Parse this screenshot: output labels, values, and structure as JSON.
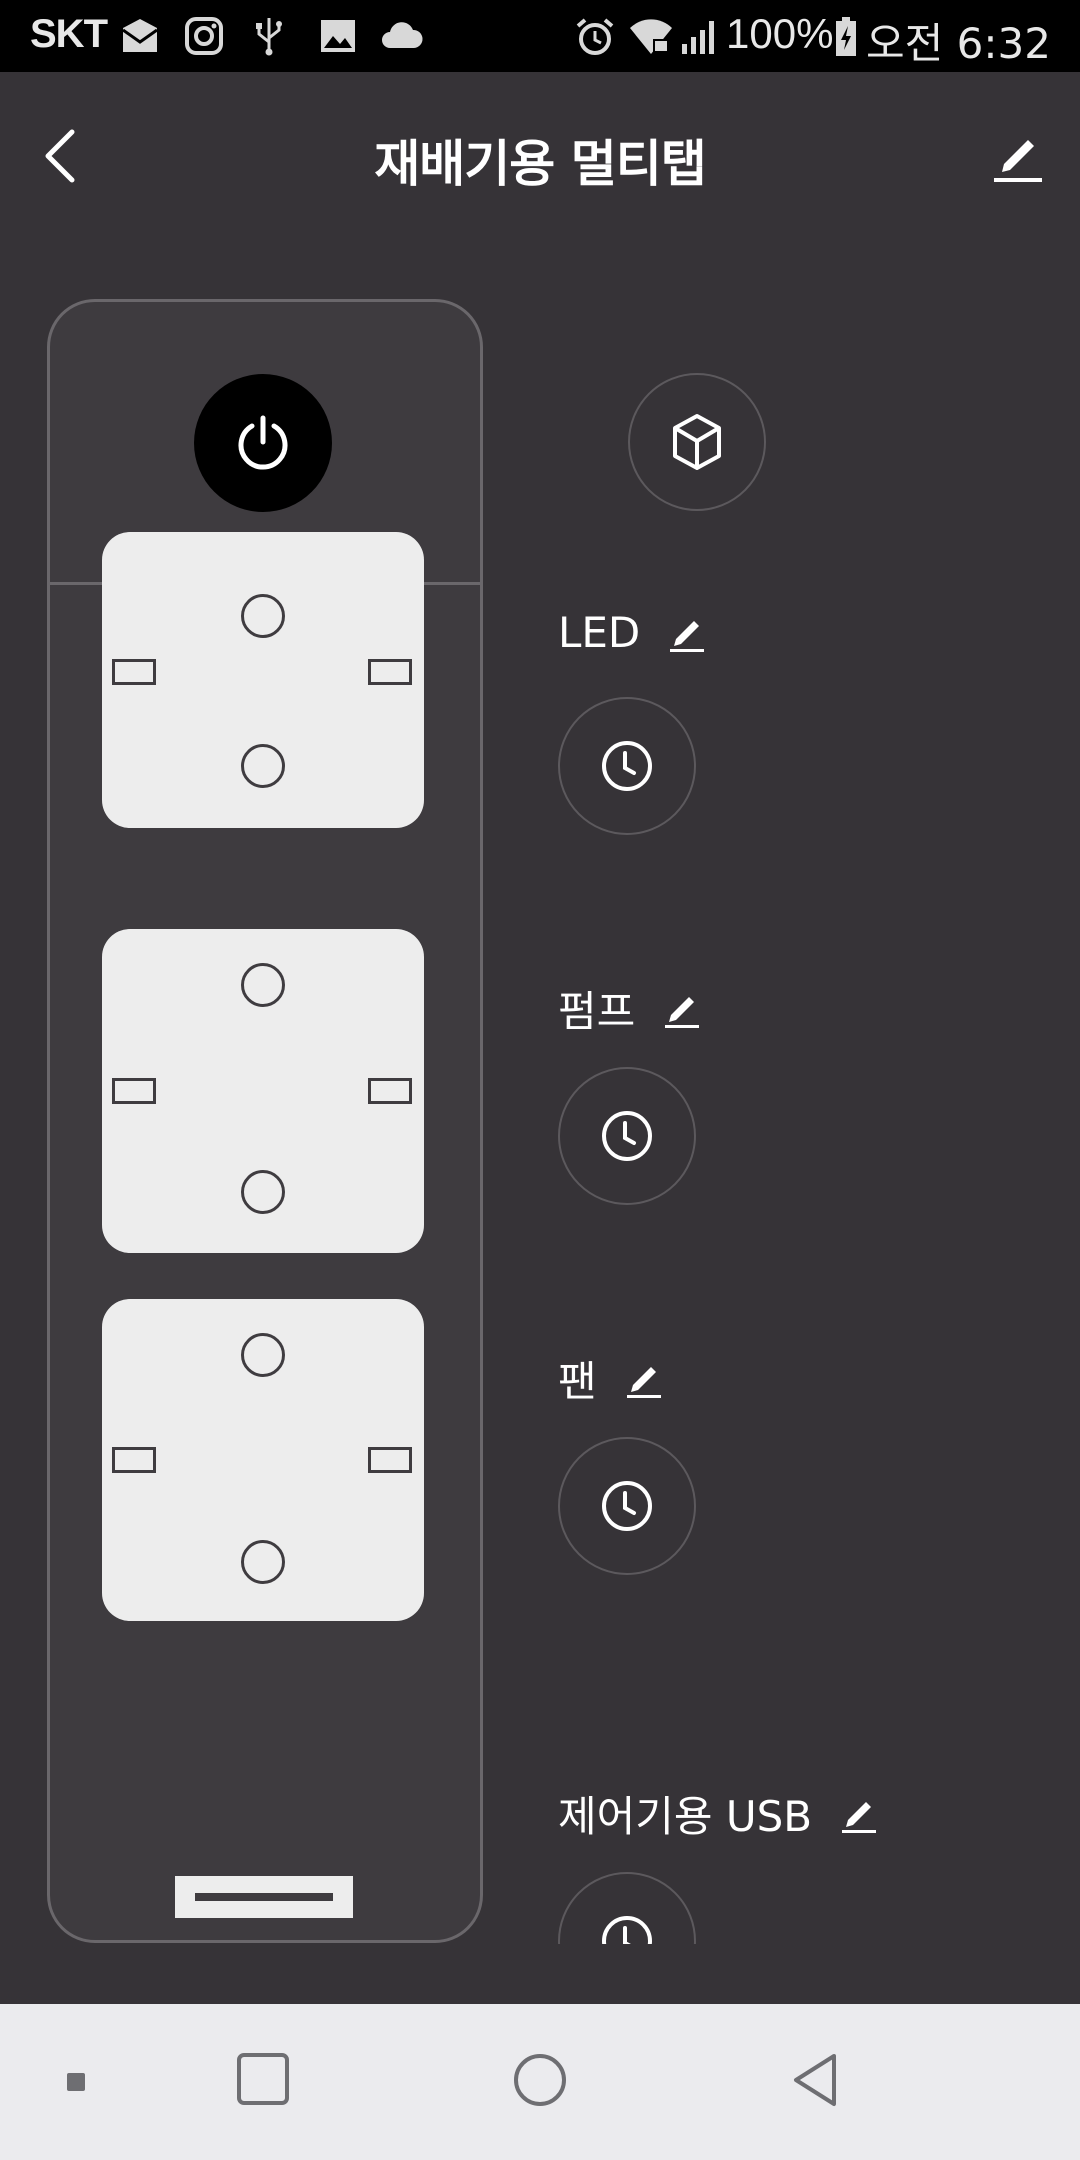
{
  "status_bar": {
    "carrier": "SKT",
    "battery": "100%",
    "time": "오전 6:32",
    "icons": [
      "mail-icon",
      "instagram-icon",
      "usb-icon",
      "image-icon",
      "cloud-icon",
      "alarm-icon",
      "wifi-icon",
      "signal-icon",
      "battery-charging-icon"
    ]
  },
  "header": {
    "title": "재배기용 멀티탭",
    "back_icon": "chevron-left-icon",
    "edit_icon": "pencil-icon"
  },
  "device": {
    "power_icon": "power-icon",
    "sockets_visible": 3
  },
  "controls": {
    "cube_icon": "cube-icon",
    "outlets": [
      {
        "label": "LED",
        "timer_icon": "clock-icon"
      },
      {
        "label": "펌프",
        "timer_icon": "clock-icon"
      },
      {
        "label": "팬",
        "timer_icon": "clock-icon"
      },
      {
        "label": "제어기용 USB",
        "timer_icon": "clock-icon"
      }
    ]
  },
  "nav_bar": {
    "buttons": [
      "dot-icon",
      "recents-icon",
      "home-icon",
      "back-icon"
    ]
  },
  "colors": {
    "background": "#363337",
    "device_fill": "#3e3b3f",
    "socket_fill": "#ededed",
    "navbar": "#ebebee"
  }
}
